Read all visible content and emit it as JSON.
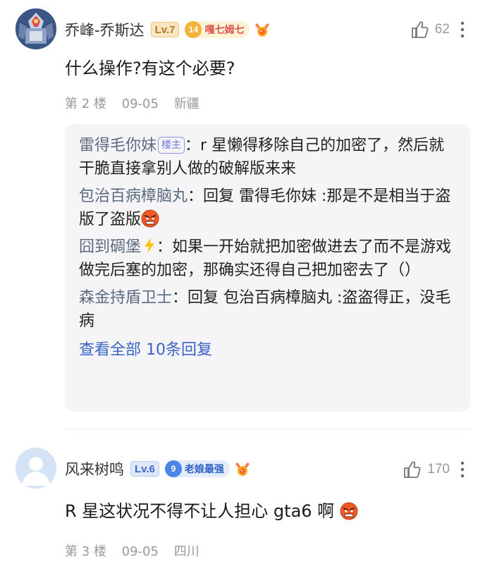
{
  "comments": [
    {
      "username": "乔峰-乔斯达",
      "level": "Lv.7",
      "fan_level": "14",
      "fan_badge": "嘎七姆七",
      "likes": "62",
      "text": "什么操作?有这个必要?",
      "floor": "第 2 楼",
      "date": "09-05",
      "location": "新疆",
      "replies": [
        {
          "author": "雷得毛你妹",
          "op_badge": "楼主",
          "separator": "：",
          "text": "r 星懒得移除自己的加密了，然后就干脆直接拿别人做的破解版来来"
        },
        {
          "author": "包治百病樟脑丸",
          "separator": "：",
          "text": "回复 雷得毛你妹 :那是不是相当于盗版了盗版"
        },
        {
          "author": "囧到碉堡",
          "separator": "：",
          "text": "如果一开始就把加密做进去了而不是游戏做完后塞的加密，那确实还得自己把加密去了（）"
        },
        {
          "author": "森金持盾卫士",
          "separator": "：",
          "text": "回复 包治百病樟脑丸 :盗盗得正，没毛病"
        }
      ],
      "view_all": "查看全部 10条回复"
    },
    {
      "username": "风来树鸣",
      "level": "Lv.6",
      "fan_level": "9",
      "fan_badge": "老娘最强",
      "likes": "170",
      "text": "R 星这状况不得不让人担心 gta6 啊",
      "floor": "第 3 楼",
      "date": "09-05",
      "location": "四川"
    }
  ],
  "icons": {
    "like": "thumbs-up-icon",
    "more": "more-vertical-icon",
    "medal": "medal-icon",
    "emoji": "angry-face-emoji-icon",
    "bolt": "lightning-bolt-icon"
  },
  "colors": {
    "author": "#5c6a80",
    "link": "#3a63c9",
    "meta": "#999999",
    "reply_bg": "#f5f5f7"
  }
}
